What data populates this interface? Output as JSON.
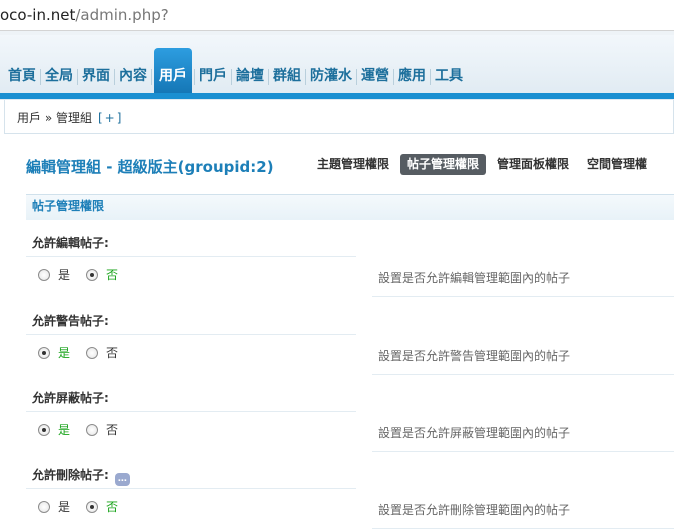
{
  "browser": {
    "url_host": "oco-in.net",
    "url_path": "/admin.php?"
  },
  "nav": {
    "items": [
      "首頁",
      "全局",
      "界面",
      "內容",
      "用戶",
      "門戶",
      "論壇",
      "群組",
      "防灌水",
      "運營",
      "應用",
      "工具"
    ],
    "active_index": 4
  },
  "breadcrumb": {
    "path": "用戶 » 管理組",
    "add_label": "[+]"
  },
  "page": {
    "title": "編輯管理組 - 超級版主(groupid:2)",
    "tabs": [
      "主題管理權限",
      "帖子管理權限",
      "管理面板權限",
      "空間管理權"
    ],
    "active_tab": 1,
    "section": "帖子管理權限"
  },
  "settings": [
    {
      "label": "允許編輯帖子:",
      "yes": "是",
      "no": "否",
      "value": "no",
      "desc": "設置是否允許編輯管理範圍內的帖子",
      "help": false
    },
    {
      "label": "允許警告帖子:",
      "yes": "是",
      "no": "否",
      "value": "yes",
      "desc": "設置是否允許警告管理範圍內的帖子",
      "help": false
    },
    {
      "label": "允許屏蔽帖子:",
      "yes": "是",
      "no": "否",
      "value": "yes",
      "desc": "設置是否允許屏蔽管理範圍內的帖子",
      "help": false
    },
    {
      "label": "允許刪除帖子:",
      "yes": "是",
      "no": "否",
      "value": "no",
      "desc": "設置是否允許刪除管理範圍內的帖子",
      "help": true
    }
  ],
  "icons": {
    "help": "help-bubble-icon"
  },
  "colors": {
    "accent": "#1d7fb8",
    "nav_bar": "#1a8fd1",
    "selected": "#18a31a",
    "active_tab": "#565c62"
  }
}
